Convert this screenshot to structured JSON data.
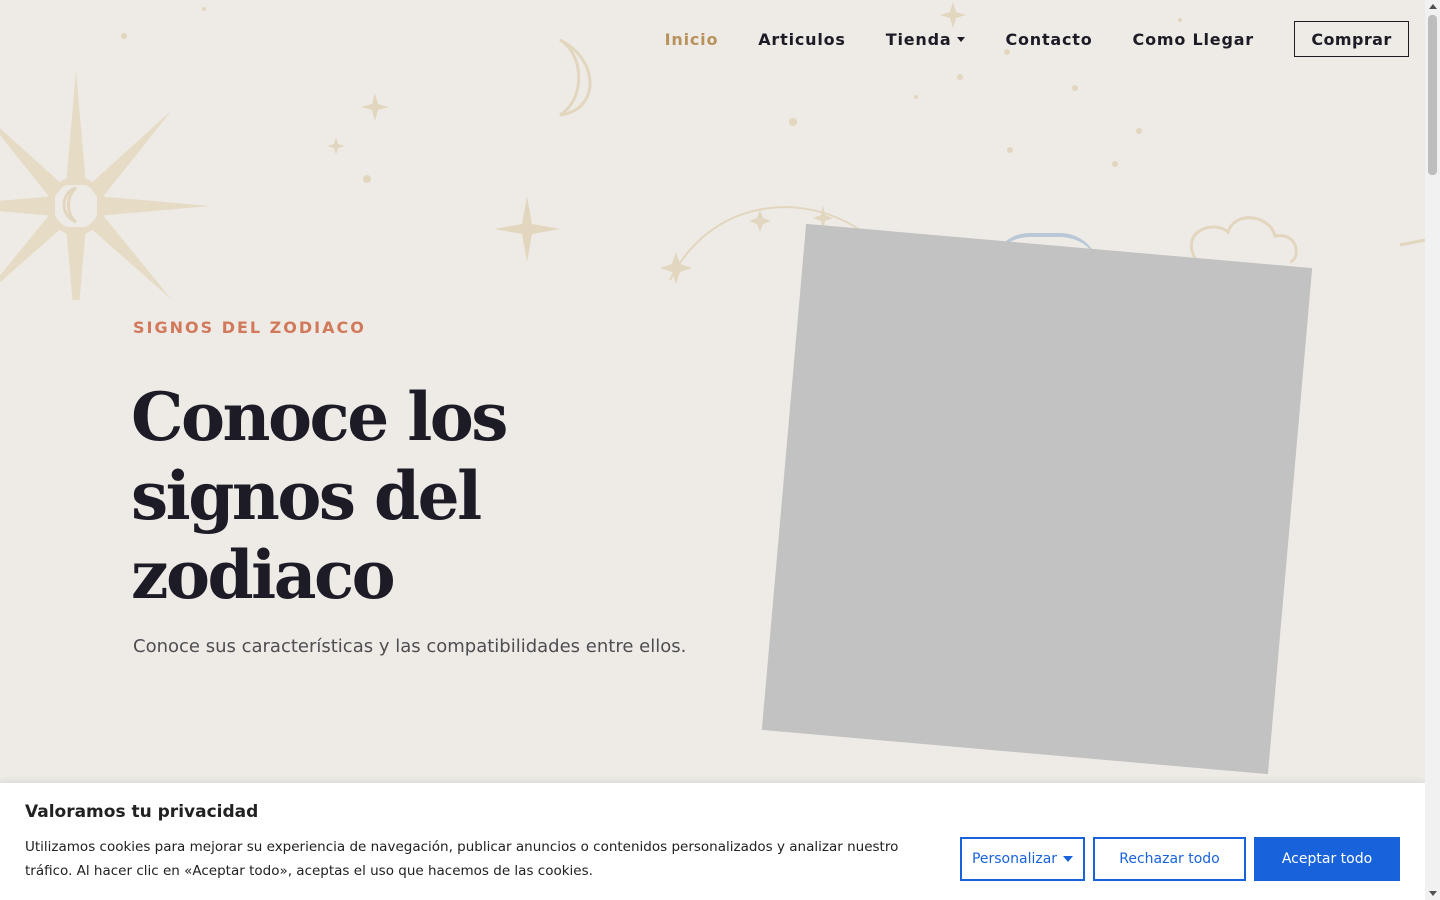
{
  "nav": {
    "items": [
      {
        "label": "Inicio",
        "active": true
      },
      {
        "label": "Articulos"
      },
      {
        "label": "Tienda",
        "has_dropdown": true
      },
      {
        "label": "Contacto"
      },
      {
        "label": "Como Llegar"
      }
    ],
    "cta_label": "Comprar"
  },
  "hero": {
    "eyebrow": "SIGNOS DEL ZODIACO",
    "title_lines": [
      "Conoce los",
      "signos del",
      "zodiaco"
    ],
    "subtitle": "Conoce sus características y las compatibilidades entre ellos."
  },
  "cookie_banner": {
    "title": "Valoramos tu privacidad",
    "text": "Utilizamos cookies para mejorar su experiencia de navegación, publicar anuncios o contenidos personalizados y analizar nuestro tráfico. Al hacer clic en «Aceptar todo», aceptas el uso que hacemos de las cookies.",
    "customize_label": "Personalizar",
    "reject_label": "Rechazar todo",
    "accept_label": "Aceptar todo"
  },
  "colors": {
    "background": "#eeebe6",
    "accent_gold": "#b8925c",
    "eyebrow_coral": "#d1795a",
    "text_dark": "#1d1b26",
    "cookie_blue": "#1863dc",
    "image_placeholder": "#c2c2c2"
  },
  "icons": [
    "sun-icon",
    "crescent-moon-icon",
    "sparkle-star-icon",
    "cloud-icon",
    "chevron-down-icon"
  ]
}
